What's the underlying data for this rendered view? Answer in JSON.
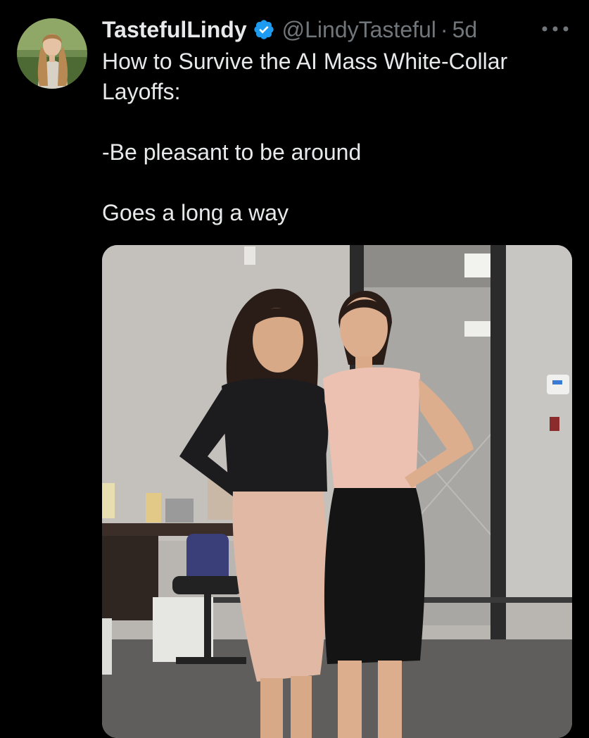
{
  "tweet": {
    "display_name": "TastefulLindy",
    "verified": true,
    "handle": "@LindyTasteful",
    "separator": "·",
    "timestamp": "5d",
    "more_label": "More",
    "text_lines": [
      "How to Survive the AI Mass White-Collar Layoffs:",
      "-Be pleasant to be around",
      "Goes a long a way"
    ]
  },
  "icons": {
    "verified": "verified-badge-icon",
    "more": "more-horizontal-icon"
  },
  "colors": {
    "background": "#000000",
    "primary_text": "#e7e9ea",
    "secondary_text": "#71767b",
    "verified_blue": "#1d9bf0"
  }
}
